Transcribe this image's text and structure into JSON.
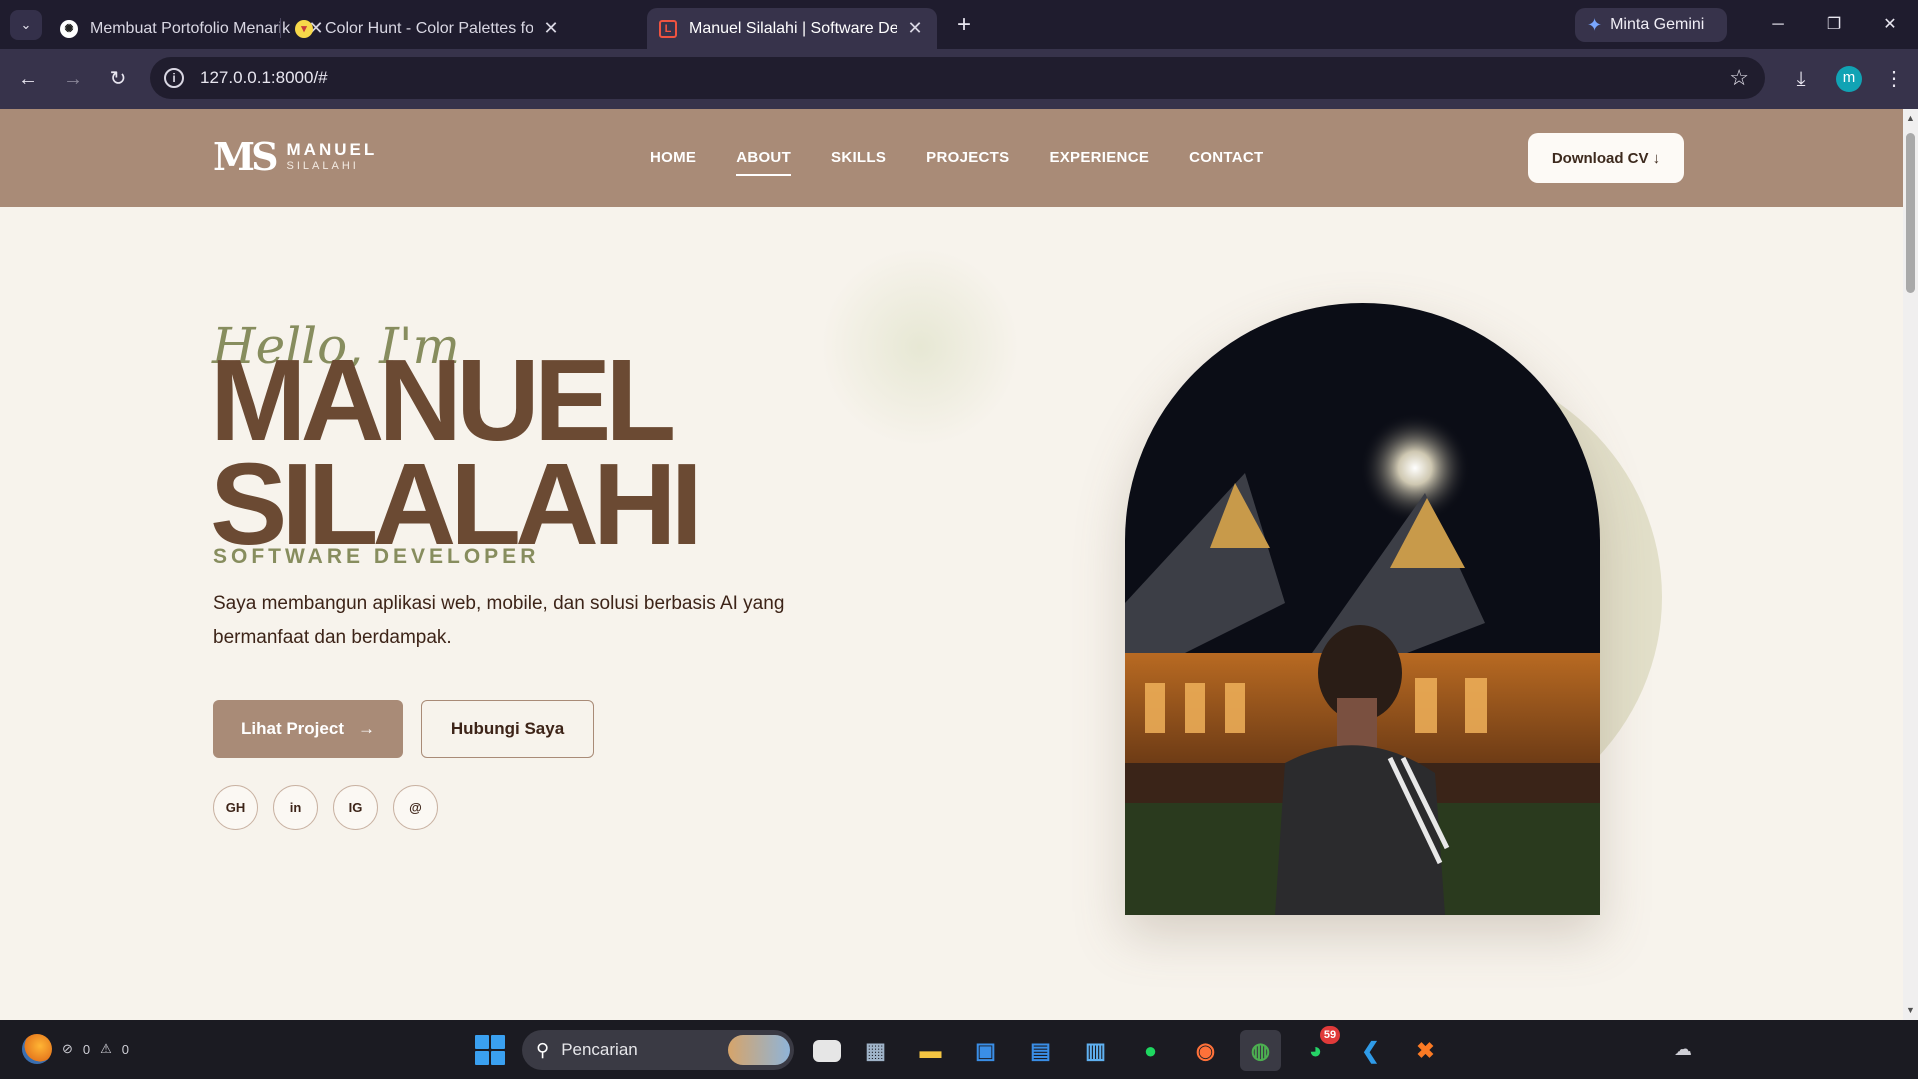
{
  "browser": {
    "tabs": [
      {
        "title": "Membuat Portofolio Menarik",
        "favicon": "chatgpt-icon"
      },
      {
        "title": "Color Hunt - Color Palettes for D",
        "favicon": "color-hunt-icon"
      },
      {
        "title": "Manuel Silalahi | Software Devel",
        "favicon": "laravel-icon",
        "active": true
      }
    ],
    "gemini_label": "Minta Gemini",
    "url": "127.0.0.1:8000/#",
    "profile_initial": "m"
  },
  "site": {
    "logo": {
      "mark": "MS",
      "name": "MANUEL",
      "sub": "SILALAHI"
    },
    "nav": [
      {
        "label": "HOME",
        "active": false
      },
      {
        "label": "ABOUT",
        "active": true
      },
      {
        "label": "SKILLS",
        "active": false
      },
      {
        "label": "PROJECTS",
        "active": false
      },
      {
        "label": "EXPERIENCE",
        "active": false
      },
      {
        "label": "CONTACT",
        "active": false
      }
    ],
    "cv_button": "Download CV ↓",
    "colors": {
      "nav_bg": "#a98b77",
      "page_bg": "#f7f3ec",
      "name_color": "#6b4a33",
      "accent_olive": "#878d5e"
    }
  },
  "hero": {
    "greeting": "Hello, I'm",
    "name_line1": "MANUEL",
    "name_line2": "SILALAHI",
    "role": "SOFTWARE DEVELOPER",
    "description": "Saya membangun aplikasi web, mobile, dan solusi berbasis AI yang bermanfaat dan berdampak.",
    "primary_button": "Lihat Project",
    "primary_arrow": "→",
    "secondary_button": "Hubungi Saya",
    "socials": [
      "GH",
      "in",
      "IG",
      "@"
    ]
  },
  "taskbar": {
    "status_counts": [
      "0",
      "0"
    ],
    "search_placeholder": "Pencarian",
    "whatsapp_badge": "59",
    "apps": [
      "file-explorer-icon",
      "calculator-icon",
      "folder-icon",
      "microsoft-store-icon",
      "calendar-icon",
      "notepad-icon",
      "spotify-icon",
      "firefox-icon",
      "chrome-icon",
      "whatsapp-icon",
      "vscode-icon",
      "xampp-icon"
    ]
  }
}
